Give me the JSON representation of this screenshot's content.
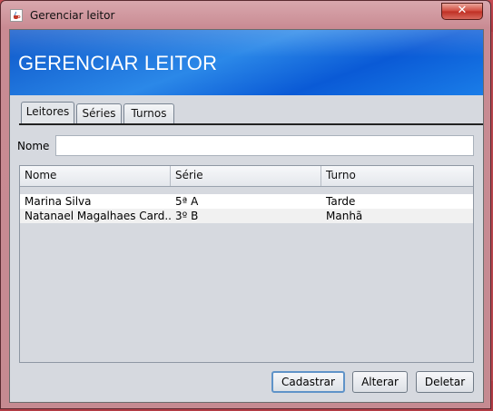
{
  "window": {
    "title": "Gerenciar leitor",
    "icon": "java-cup-icon",
    "close_label": "✕"
  },
  "header": {
    "title": "GERENCIAR LEITOR"
  },
  "tabs": [
    {
      "label": "Leitores",
      "active": true
    },
    {
      "label": "Séries",
      "active": false
    },
    {
      "label": "Turnos",
      "active": false
    }
  ],
  "form": {
    "name_label": "Nome",
    "name_value": ""
  },
  "table": {
    "columns": [
      "Nome",
      "Série",
      "Turno"
    ],
    "rows": [
      [
        "Marina Silva",
        "5ª A",
        "Tarde"
      ],
      [
        "Natanael Magalhaes Card...",
        "3º B",
        "Manhã"
      ]
    ]
  },
  "buttons": {
    "register": "Cadastrar",
    "edit": "Alterar",
    "delete": "Deletar"
  },
  "colors": {
    "banner": "#1a6fe0",
    "panel": "#d6d9df",
    "default_button_border": "#5f93c8"
  }
}
